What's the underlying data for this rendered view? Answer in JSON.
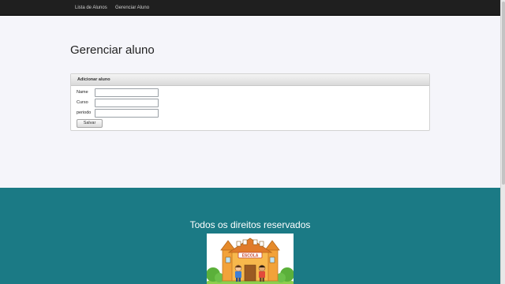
{
  "nav": {
    "items": [
      {
        "label": "Lista de Alunos"
      },
      {
        "label": "Gerenciar Aluno"
      }
    ]
  },
  "page": {
    "title": "Gerenciar aluno"
  },
  "panel": {
    "header": "Adicionar aluno",
    "fields": [
      {
        "label": "Name",
        "value": ""
      },
      {
        "label": "Curso",
        "value": ""
      },
      {
        "label": "periodo",
        "value": ""
      }
    ],
    "save_label": "Salvar"
  },
  "footer": {
    "text": "Todos os direitos reservados",
    "image_label": "ESCOLA",
    "background": "#1b7a85"
  }
}
